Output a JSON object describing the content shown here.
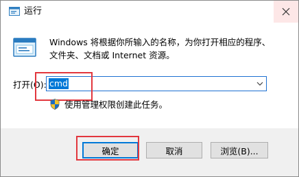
{
  "window": {
    "title": "运行",
    "app_icon": "run-icon",
    "close_icon": "close-icon"
  },
  "description": {
    "line1": "Windows 将根据你所输入的名称，为你打开相应的程序、",
    "line2": "文件夹、文档或 Internet 资源。"
  },
  "open": {
    "label": "打开(O):",
    "value": "cmd",
    "dropdown_icon": "chevron-down-icon"
  },
  "admin_note": {
    "icon": "uac-shield-icon",
    "text": "使用管理权限创建此任务。"
  },
  "buttons": {
    "ok": "确定",
    "cancel": "取消",
    "browse": "浏览(B)..."
  },
  "colors": {
    "accent": "#0078d7",
    "highlight_annotation": "#e2363d",
    "close_hover": "#fde7e7"
  }
}
